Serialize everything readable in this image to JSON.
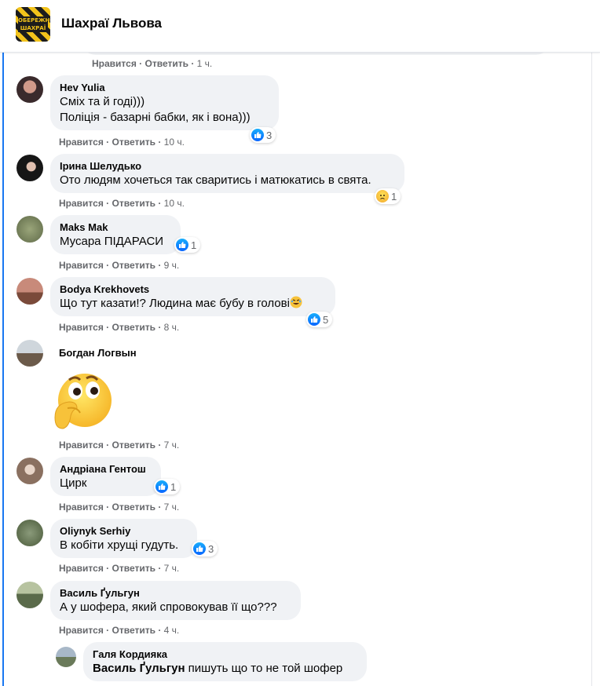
{
  "header": {
    "group_name": "Шахраї Львова",
    "logo_text_1": "ОБЕРЕЖНО",
    "logo_text_2": "ШАХРАЇ"
  },
  "actions": {
    "like": "Нравится",
    "reply": "Ответить",
    "sep": "·"
  },
  "colors": {
    "accent": "#1877f2",
    "bubble": "#f0f2f5",
    "meta": "#65676b"
  },
  "prev_meta": {
    "time": "1 ч."
  },
  "comments": [
    {
      "name": "Hev Yulia",
      "lines": [
        "Сміх та й годі)))",
        "Поліція - базарні бабки, як і вона)))"
      ],
      "reaction": "like",
      "count": "3",
      "time": "10 ч."
    },
    {
      "name": "Ірина Шелудько",
      "lines": [
        "Ото людям хочеться так сваритись і матюкатись в свята."
      ],
      "reaction": "sad",
      "count": "1",
      "time": "10 ч."
    },
    {
      "name": "Maks Mak",
      "lines": [
        "Мусара ПІДАРАСИ"
      ],
      "reaction": "like",
      "count": "1",
      "time": "9 ч."
    },
    {
      "name": "Bodya Krekhovets",
      "lines": [
        "Що тут казати!? Людина має бубу в голові"
      ],
      "emoji": "rofl-emoji",
      "reaction": "like",
      "count": "5",
      "time": "8 ч."
    },
    {
      "name": "Богдан Логвын",
      "sticker": "thinking-face-emoji",
      "time": "7 ч."
    },
    {
      "name": "Андріана Гентош",
      "lines": [
        "Цирк"
      ],
      "reaction": "like",
      "count": "1",
      "time": "7 ч."
    },
    {
      "name": "Oliynyk Serhiy",
      "lines": [
        "В кобіти хрущі гудуть."
      ],
      "reaction": "like",
      "count": "3",
      "time": "7 ч."
    },
    {
      "name": "Василь Ґульгун",
      "lines": [
        "А у шофера, який спровокував її що???"
      ],
      "time": "4 ч."
    }
  ],
  "reply": {
    "name": "Галя Кордияка",
    "mention": "Василь Ґульгун",
    "text": " пишуть що то не той шофер"
  }
}
